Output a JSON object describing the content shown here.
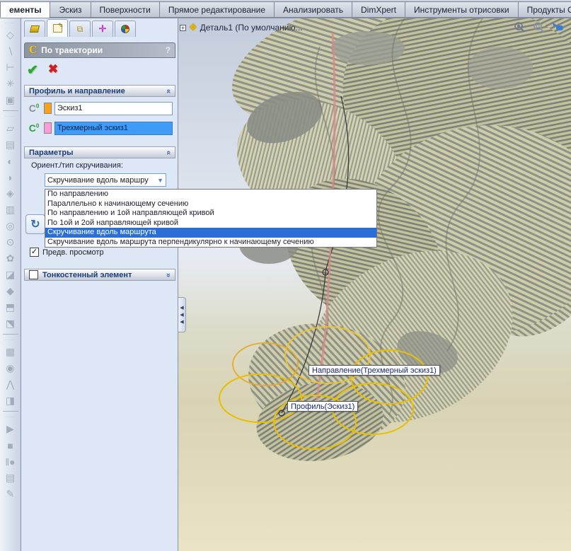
{
  "ribbon": {
    "tabs": [
      {
        "label": "ементы",
        "active": true
      },
      {
        "label": "Эскиз",
        "active": false
      },
      {
        "label": "Поверхности",
        "active": false
      },
      {
        "label": "Прямое редактирование",
        "active": false
      },
      {
        "label": "Анализировать",
        "active": false
      },
      {
        "label": "DimXpert",
        "active": false
      },
      {
        "label": "Инструменты отрисовки",
        "active": false
      },
      {
        "label": "Продукты Office",
        "active": false
      }
    ]
  },
  "left_toolbar": {
    "groups": [
      [
        {
          "name": "plane-tool",
          "glyph": "◇"
        },
        {
          "name": "line-tool",
          "glyph": "∖"
        },
        {
          "name": "axis-tool",
          "glyph": "⊢"
        },
        {
          "name": "point-tool",
          "glyph": "✳"
        },
        {
          "name": "extrude-tool",
          "glyph": "▣"
        }
      ],
      [
        {
          "name": "surface-plane-tool",
          "glyph": "▱"
        },
        {
          "name": "surface-offset-tool",
          "glyph": "▤"
        },
        {
          "name": "surface-revolve-tool",
          "glyph": "◐"
        },
        {
          "name": "surface-sweep-tool",
          "glyph": "◗"
        },
        {
          "name": "surface-loft-tool",
          "glyph": "◈"
        },
        {
          "name": "surface-fill-tool",
          "glyph": "▥"
        },
        {
          "name": "filter-solid-tool",
          "glyph": "◎"
        },
        {
          "name": "filter-gear-tool",
          "glyph": "⊙"
        },
        {
          "name": "gear-tool",
          "glyph": "✿"
        },
        {
          "name": "surface-trim-tool",
          "glyph": "◪"
        },
        {
          "name": "surface-wedge-tool",
          "glyph": "◆"
        },
        {
          "name": "move-face-tool",
          "glyph": "⬒"
        },
        {
          "name": "copy-bodies-tool",
          "glyph": "⬔"
        }
      ],
      [
        {
          "name": "stamp-tool",
          "glyph": "▦"
        },
        {
          "name": "revolve-surface-tool",
          "glyph": "◉"
        },
        {
          "name": "flatten-tool",
          "glyph": "⋀"
        },
        {
          "name": "preview-body-tool",
          "glyph": "◨"
        }
      ],
      [
        {
          "name": "play-button",
          "glyph": "▶"
        },
        {
          "name": "stop-button",
          "glyph": "■"
        },
        {
          "name": "pause-record-button",
          "glyph": "‖●"
        },
        {
          "name": "design-binder-button",
          "glyph": "▤"
        },
        {
          "name": "edit-annotations-button",
          "glyph": "✎"
        }
      ]
    ]
  },
  "property_manager": {
    "title": "По траектории",
    "help_label": "?",
    "profile_section": {
      "header": "Профиль и направление",
      "profile_field": {
        "value": "Эскиз1",
        "swatch": "#f6a21c"
      },
      "path_field": {
        "value": "Трехмерный эскиз1",
        "swatch": "#f99dd4"
      }
    },
    "parameters_section": {
      "header": "Параметры",
      "orientation_label": "Ориент./тип скручивания:",
      "combo_value": "Скручивание вдоль маршру",
      "options": [
        "По направлению",
        "Параллельно к начинающему сечению",
        "По направлению и 1ой  направляющей кривой",
        "По  1ой  и 2ой направляющей кривой",
        "Скручивание вдоль маршрута",
        "Скручивание вдоль маршрута перпендикулярно к начинающему сечению"
      ],
      "selected_index": 4,
      "preview_label": "Предв. просмотр",
      "preview_checked": true
    },
    "thin_section": {
      "header": "Тонкостенный элемент",
      "checked": false
    }
  },
  "viewport": {
    "doc_label": "Деталь1  (По умолчанию...",
    "tooltips": {
      "direction": "Направление(Трехмерный эскиз1)",
      "profile": "Профиль(Эскиз1)"
    }
  },
  "colors": {
    "selection_blue": "#2b6fd6",
    "highlight_yellow": "#e9bf00",
    "panel_bg": "#dde7f6"
  }
}
